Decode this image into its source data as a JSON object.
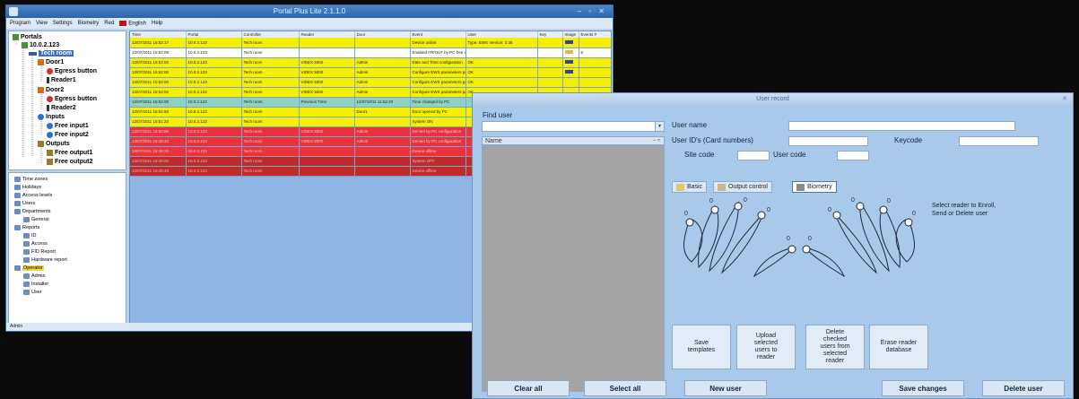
{
  "main_window": {
    "title": "Portal Plus Lite 2.1.1.0",
    "menu": [
      "Program",
      "View",
      "Settings",
      "Biometry",
      "Red",
      "English",
      "Help"
    ],
    "status_text": "Admin"
  },
  "tree": {
    "root": "Portals",
    "ip": "10.0.2.123",
    "room": "Tech room",
    "door1": "Door1",
    "egress1": "Egress button",
    "reader1": "Reader1",
    "door2": "Door2",
    "egress2": "Egress button",
    "reader2": "Reader2",
    "inputs": "Inputs",
    "input1": "Free input1",
    "input2": "Free input2",
    "outputs": "Outputs",
    "output1": "Free output1",
    "output2": "Free output2"
  },
  "nav": {
    "items": [
      "Time zones",
      "Holidays",
      "Access levels",
      "Users",
      "Departments",
      "General",
      "Reports",
      "ID",
      "Access",
      "FID Report",
      "Hardware report",
      "Operator",
      "Admin",
      "Installer",
      "User"
    ]
  },
  "events": {
    "columns": [
      "Time",
      "Portal",
      "Controller",
      "Reader",
      "Door",
      "Event",
      "User",
      "Key",
      "Image",
      "Events #"
    ],
    "rows": [
      {
        "color": "yellow",
        "cells": [
          "12/07/2011 15:52:17",
          "10.0.2.123",
          "Tech room",
          "",
          "",
          "Device online",
          "Type: EWS Version: 2.35",
          "",
          "img",
          ""
        ]
      },
      {
        "color": "white",
        "cells": [
          "12/07/2011 15:52:09",
          "10.0.2.123",
          "Tech room",
          "",
          "",
          "Enabled FR/OUT by PC free output",
          "",
          "",
          "img2",
          "5"
        ]
      },
      {
        "color": "yellow",
        "cells": [
          "12/07/2011 15:52:00",
          "10.0.2.123",
          "Tech room",
          "VIDEX 5000",
          "Admin",
          "Date and Time configuration",
          "OK",
          "",
          "img",
          ""
        ]
      },
      {
        "color": "yellow",
        "cells": [
          "12/07/2011 15:52:00",
          "10.0.2.123",
          "Tech room",
          "VIDEX 5000",
          "Admin",
          "Configure EWS parameters part 3",
          "OK",
          "",
          "img",
          ""
        ]
      },
      {
        "color": "yellow",
        "cells": [
          "12/07/2011 15:52:00",
          "10.0.2.123",
          "Tech room",
          "VIDEX 5000",
          "Admin",
          "Configure EWS parameters part 2",
          "OK",
          "",
          "",
          ""
        ]
      },
      {
        "color": "yellow",
        "cells": [
          "12/07/2011 15:52:00",
          "10.0.2.123",
          "Tech room",
          "VIDEX 5000",
          "Admin",
          "Configure EWS parameters part 1",
          "OK",
          "",
          "",
          ""
        ]
      },
      {
        "color": "teal",
        "cells": [
          "12/07/2011 15:52:00",
          "10.0.2.123",
          "Tech room",
          "Previous Time",
          "12/07/2011 11:52:20",
          "Time changed by PC",
          "",
          "",
          "",
          ""
        ]
      },
      {
        "color": "yellow",
        "cells": [
          "12/07/2011 15:51:50",
          "10.0.2.123",
          "Tech room",
          "",
          "Door1",
          "Door opened by PC",
          "",
          "",
          "",
          ""
        ]
      },
      {
        "color": "yellow",
        "cells": [
          "12/07/2011 15:51:20",
          "10.0.2.123",
          "Tech room",
          "",
          "",
          "System ON",
          "",
          "",
          "",
          ""
        ]
      },
      {
        "color": "red",
        "cells": [
          "12/07/2011 15:50:00",
          "10.0.2.123",
          "Tech room",
          "VIDEX 5000",
          "Admin",
          "Denied by PC configuration",
          "",
          "",
          "",
          ""
        ]
      },
      {
        "color": "red",
        "cells": [
          "12/07/2011 15:49:40",
          "10.0.2.123",
          "Tech room",
          "VIDEX 5000",
          "Admin",
          "Denied by PC configuration",
          "",
          "",
          "",
          ""
        ]
      },
      {
        "color": "red",
        "cells": [
          "12/07/2011 15:49:20",
          "10.0.2.123",
          "Tech room",
          "",
          "",
          "Device offline",
          "",
          "",
          "",
          ""
        ]
      },
      {
        "color": "darkred",
        "cells": [
          "12/07/2011 15:49:00",
          "10.0.2.123",
          "Tech room",
          "",
          "",
          "System OFF",
          "",
          "",
          "",
          ""
        ]
      },
      {
        "color": "darkred",
        "cells": [
          "12/07/2011 15:48:40",
          "10.0.2.123",
          "Tech room",
          "",
          "",
          "Device offline",
          "",
          "",
          "",
          ""
        ]
      }
    ]
  },
  "user_window": {
    "title": "User record",
    "find_user_label": "Find user",
    "list_header": "Name",
    "user_name_label": "User name",
    "user_ids_label": "User ID's (Card numbers)",
    "keycode_label": "Keycode",
    "site_code_label": "Site code",
    "user_code_label": "User code",
    "tabs": [
      "Basic",
      "Output control",
      "Biometry"
    ],
    "finger_labels": [
      "0",
      "0",
      "0",
      "0",
      "0",
      "0",
      "0",
      "0",
      "0",
      "0"
    ],
    "hint": "Select reader to Enroll,\nSend or Delete user",
    "actions": [
      "Save\ntemplates",
      "Upload\nselected\nusers to\nreader",
      "Delete\nchecked\nusers from\nselected\nreader",
      "Erase reader\ndatabase"
    ],
    "clear_all": "Clear all",
    "select_all": "Select all",
    "new_user": "New user",
    "save_changes": "Save changes",
    "delete_user": "Delete user"
  }
}
